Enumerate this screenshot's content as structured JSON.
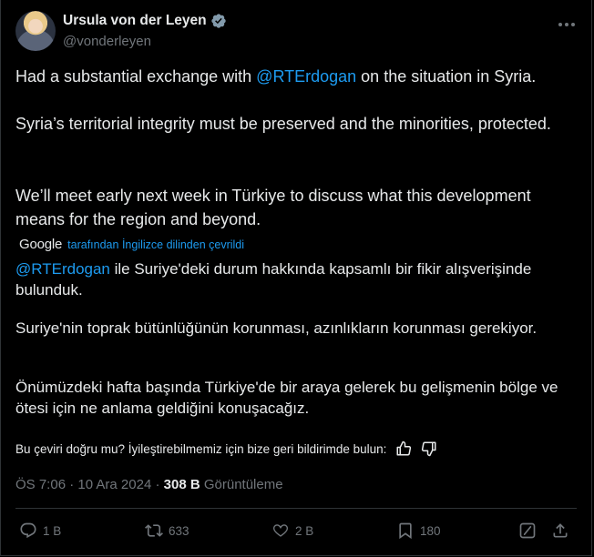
{
  "author": {
    "name": "Ursula von der Leyen",
    "handle": "@vonderleyen"
  },
  "tweet": {
    "p1_before": "Had a substantial exchange with ",
    "p1_mention": "@RTErdogan",
    "p1_after": " on the situation in Syria.",
    "p2": "Syria’s territorial integrity must be preserved and the minorities, protected.",
    "p3": "We’ll meet early next week in Türkiye to discuss what this development means for the region and beyond."
  },
  "translation": {
    "google_label": "Google",
    "by_text": "tarafından İngilizce dilinden çevrildi",
    "t1_mention": "@RTErdogan",
    "t1_rest": " ile Suriye'deki durum hakkında kapsamlı bir fikir alışverişinde bulunduk.",
    "t2": "Suriye'nin toprak bütünlüğünün korunması, azınlıkların korunması gerekiyor.",
    "t3": "Önümüzdeki hafta başında Türkiye'de bir araya gelerek bu gelişmenin bölge ve ötesi için ne anlama geldiğini konuşacağız.",
    "feedback": "Bu çeviri doğru mu? İyileştirebilmemiz için bize geri bildirimde bulun:"
  },
  "meta": {
    "time": "ÖS 7:06",
    "separator": "·",
    "date": "10 Ara 2024",
    "views_count": "308 B",
    "views_label": "Görüntüleme"
  },
  "actions": {
    "replies": "1 B",
    "reposts": "633",
    "likes": "2 B",
    "bookmarks": "180"
  },
  "colors": {
    "background": "#000000",
    "text": "#e7e9ea",
    "muted": "#71767b",
    "accent": "#1d9bf0"
  },
  "icons": [
    "verified-badge-icon",
    "more-icon",
    "thumbs-up-icon",
    "thumbs-down-icon",
    "reply-icon",
    "repost-icon",
    "like-icon",
    "bookmark-icon",
    "grok-icon",
    "share-icon"
  ]
}
